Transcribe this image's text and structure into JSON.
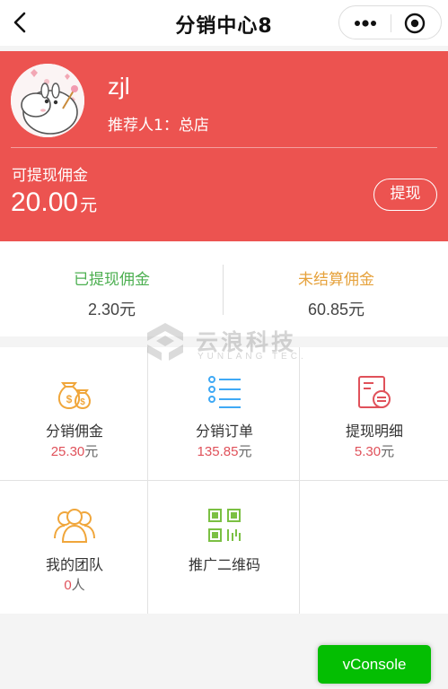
{
  "navbar": {
    "title": "分销中心8",
    "back_icon": "chevron-left-icon",
    "more_icon": "more-dots-icon",
    "close_icon": "target-circle-icon"
  },
  "profile": {
    "username": "zjl",
    "referrer": "推荐人1：总店",
    "avatar_icon": "moomin-avatar"
  },
  "withdrawable": {
    "label": "可提现佣金",
    "amount": "20.00",
    "unit": "元",
    "button_label": "提现"
  },
  "stats": [
    {
      "label": "已提现佣金",
      "value": "2.30元",
      "color": "#4caf50"
    },
    {
      "label": "未结算佣金",
      "value": "60.85元",
      "color": "#e6a23c"
    }
  ],
  "watermark": {
    "cn": "云浪科技",
    "en": "YUNLANG TEC."
  },
  "grid": [
    {
      "label": "分销佣金",
      "num": "25.30",
      "unit": "元",
      "icon": "money-bags-icon",
      "color": "#f0a63b"
    },
    {
      "label": "分销订单",
      "num": "135.85",
      "unit": "元",
      "icon": "list-icon",
      "color": "#3fa9f5"
    },
    {
      "label": "提现明细",
      "num": "5.30",
      "unit": "元",
      "icon": "receipt-exchange-icon",
      "color": "#e0515a"
    },
    {
      "label": "我的团队",
      "num": "0",
      "unit": "人",
      "icon": "team-icon",
      "color": "#f0a63b"
    },
    {
      "label": "推广二维码",
      "num": "",
      "unit": "",
      "icon": "qr-code-icon",
      "color": "#7bc043"
    }
  ],
  "vconsole": {
    "label": "vConsole"
  },
  "colors": {
    "brand_red": "#ec5350",
    "vconsole_green": "#04be02"
  }
}
